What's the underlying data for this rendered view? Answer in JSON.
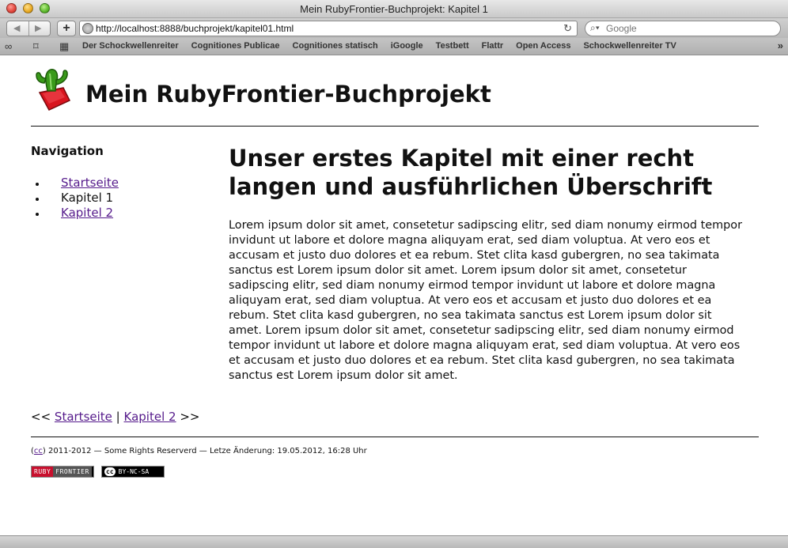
{
  "window": {
    "title": "Mein RubyFrontier-Buchprojekt: Kapitel 1"
  },
  "toolbar": {
    "back_icon": "back-arrow-icon",
    "forward_icon": "forward-arrow-icon",
    "add_label": "+",
    "url": "http://localhost:8888/buchprojekt/kapitel01.html",
    "search_placeholder": "Google"
  },
  "bookmarks": {
    "items": [
      "Der Schockwellenreiter",
      "Cognitiones Publicae",
      "Cognitiones statisch",
      "iGoogle",
      "Testbett",
      "Flattr",
      "Open Access",
      "Schockwellenreiter TV"
    ]
  },
  "site": {
    "title": "Mein RubyFrontier-Buchprojekt"
  },
  "nav": {
    "heading": "Navigation",
    "items": [
      {
        "label": "Startseite",
        "link": true
      },
      {
        "label": "Kapitel 1",
        "link": false
      },
      {
        "label": "Kapitel 2",
        "link": true
      }
    ]
  },
  "article": {
    "title": "Unser erstes Kapitel mit einer recht langen und ausführlichen Überschrift",
    "body": "Lorem ipsum dolor sit amet, consetetur sadipscing elitr, sed diam nonumy eirmod tempor invidunt ut labore et dolore magna aliquyam erat, sed diam voluptua. At vero eos et accusam et justo duo dolores et ea rebum. Stet clita kasd gubergren, no sea takimata sanctus est Lorem ipsum dolor sit amet. Lorem ipsum dolor sit amet, consetetur sadipscing elitr, sed diam nonumy eirmod tempor invidunt ut labore et dolore magna aliquyam erat, sed diam voluptua. At vero eos et accusam et justo duo dolores et ea rebum. Stet clita kasd gubergren, no sea takimata sanctus est Lorem ipsum dolor sit amet. Lorem ipsum dolor sit amet, consetetur sadipscing elitr, sed diam nonumy eirmod tempor invidunt ut labore et dolore magna aliquyam erat, sed diam voluptua. At vero eos et accusam et justo duo dolores et ea rebum. Stet clita kasd gubergren, no sea takimata sanctus est Lorem ipsum dolor sit amet."
  },
  "pager": {
    "prev_arrows": "<<",
    "prev_label": "Startseite",
    "separator": "|",
    "next_label": "Kapitel 2",
    "next_arrows": ">>"
  },
  "footer": {
    "cc_label": "cc",
    "text": "2011-2012 — Some Rights Reserverd — Letze Änderung: 19.05.2012, 16:28 Uhr",
    "badge_ruby": "RUBY",
    "badge_frontier": "FRONTIER",
    "badge_cc": "cc",
    "badge_license": "BY-NC-SA"
  },
  "colors": {
    "link": "#551a8b",
    "text": "#111111",
    "logo_green": "#3a9a1a",
    "logo_red": "#d8141e"
  }
}
